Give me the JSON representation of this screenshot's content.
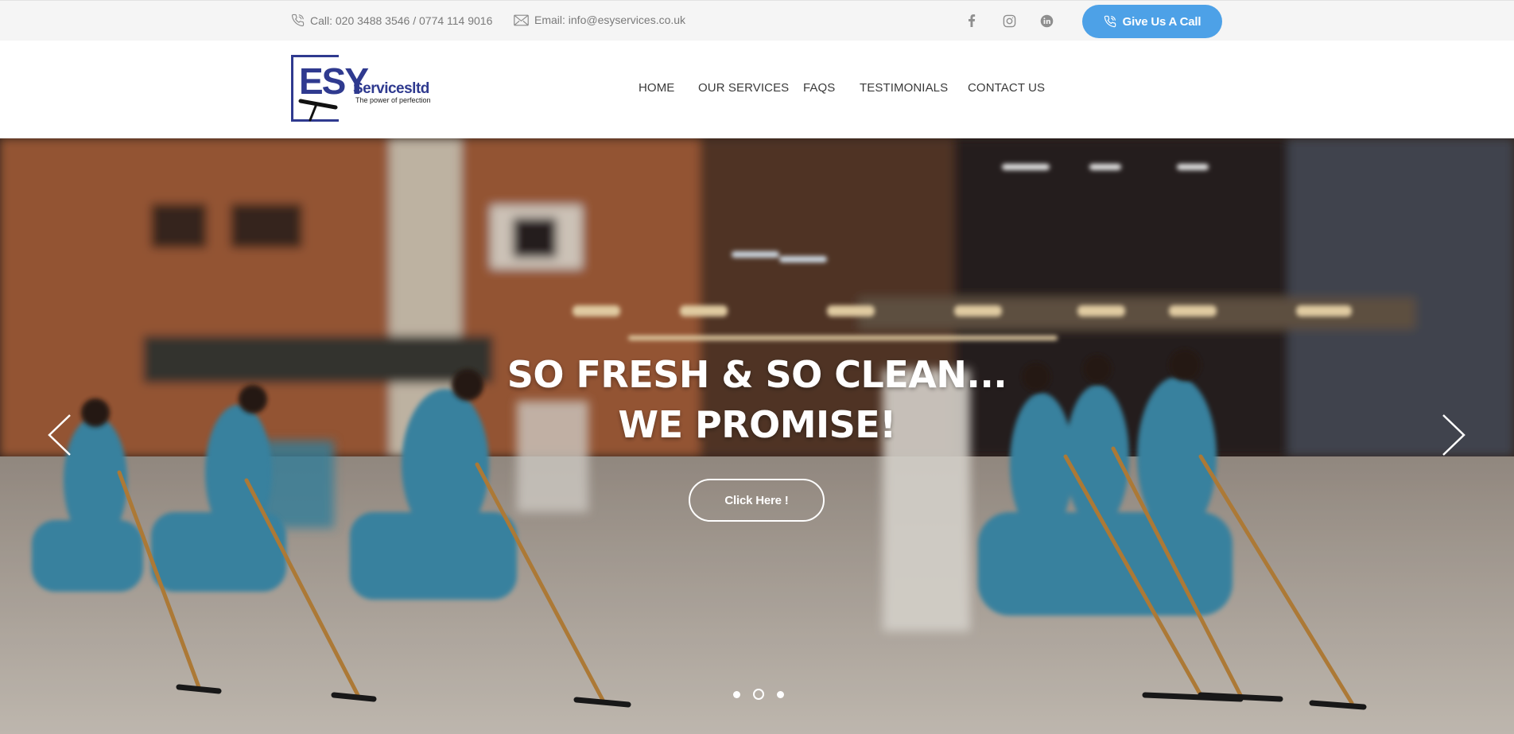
{
  "topbar": {
    "phone_text": "Call: 020 3488 3546 / 0774 114 9016",
    "email_text": "Email: info@esyservices.co.uk",
    "social_icons": [
      "facebook-icon",
      "instagram-icon",
      "linkedin-icon"
    ],
    "call_button_label": "Give Us A Call",
    "call_button_color": "#4da1e7"
  },
  "logo": {
    "mark": "ESY",
    "name": "Servicesltd",
    "tagline": "The power of perfection",
    "brand_color": "#2f3a8f"
  },
  "nav": {
    "items": [
      {
        "label": "HOME"
      },
      {
        "label": "OUR SERVICES"
      },
      {
        "label": "FAQS"
      },
      {
        "label": "TESTIMONIALS"
      },
      {
        "label": "CONTACT US"
      }
    ]
  },
  "hero": {
    "title_line1": "SO FRESH & SO CLEAN...",
    "title_line2": "WE PROMISE!",
    "button_label": "Click Here !",
    "slide_count": 3,
    "active_slide": 2
  }
}
